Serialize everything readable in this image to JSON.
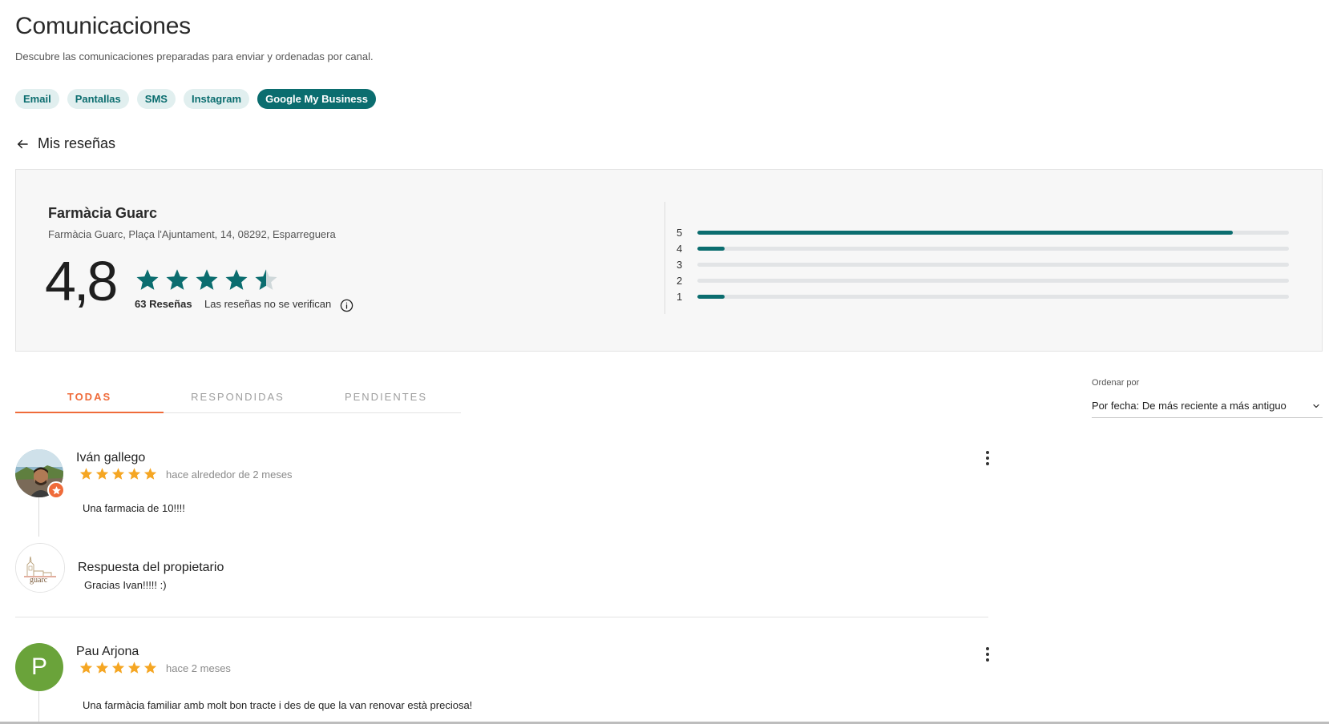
{
  "header": {
    "title": "Comunicaciones",
    "subtitle": "Descubre las comunicaciones preparadas para enviar y ordenadas por canal."
  },
  "channels": [
    {
      "label": "Email",
      "active": false
    },
    {
      "label": "Pantallas",
      "active": false
    },
    {
      "label": "SMS",
      "active": false
    },
    {
      "label": "Instagram",
      "active": false
    },
    {
      "label": "Google My Business",
      "active": true
    }
  ],
  "section": {
    "back_icon": "arrow-left-icon",
    "title": "Mis reseñas"
  },
  "summary": {
    "business_name": "Farmàcia Guarc",
    "address": "Farmàcia Guarc, Plaça l'Ajuntament, 14, 08292, Esparreguera",
    "rating": "4,8",
    "rating_value": 4.8,
    "reviews_count": "63 Reseñas",
    "verification_note": "Las reseñas no se verifican",
    "info_icon": "info-icon",
    "distribution": [
      {
        "label": "5",
        "fraction": 0.905
      },
      {
        "label": "4",
        "fraction": 0.046
      },
      {
        "label": "3",
        "fraction": 0.0
      },
      {
        "label": "2",
        "fraction": 0.0
      },
      {
        "label": "1",
        "fraction": 0.046
      }
    ]
  },
  "tabs": [
    {
      "label": "TODAS",
      "active": true
    },
    {
      "label": "RESPONDIDAS",
      "active": false
    },
    {
      "label": "PENDIENTES",
      "active": false
    }
  ],
  "sort": {
    "label": "Ordenar por",
    "value": "Por fecha: De más reciente a más antiguo",
    "icon": "chevron-down-icon"
  },
  "reviews": [
    {
      "author": "Iván gallego",
      "avatar": "user-photo",
      "badge_icon": "local-guide-star-icon",
      "stars": 5,
      "date": "hace alrededor de 2 meses",
      "text": "Una farmacia de 10!!!!",
      "menu_icon": "more-vertical-icon",
      "reply": {
        "avatar": "business-logo",
        "logo_text": "guarc",
        "title": "Respuesta del propietario",
        "text": "Gracias Ivan!!!!! :)"
      }
    },
    {
      "author": "Pau Arjona",
      "avatar_letter": "P",
      "stars": 5,
      "date": "hace 2 meses",
      "text": "Una farmàcia familiar amb molt bon tracte i des de que la van renovar està preciosa!",
      "menu_icon": "more-vertical-icon"
    }
  ],
  "colors": {
    "primary": "#0b6d6f",
    "chip_bg": "#e1efef",
    "accent": "#ef6b3a",
    "star": "#f5a623",
    "avatar_green": "#6aa33a"
  }
}
